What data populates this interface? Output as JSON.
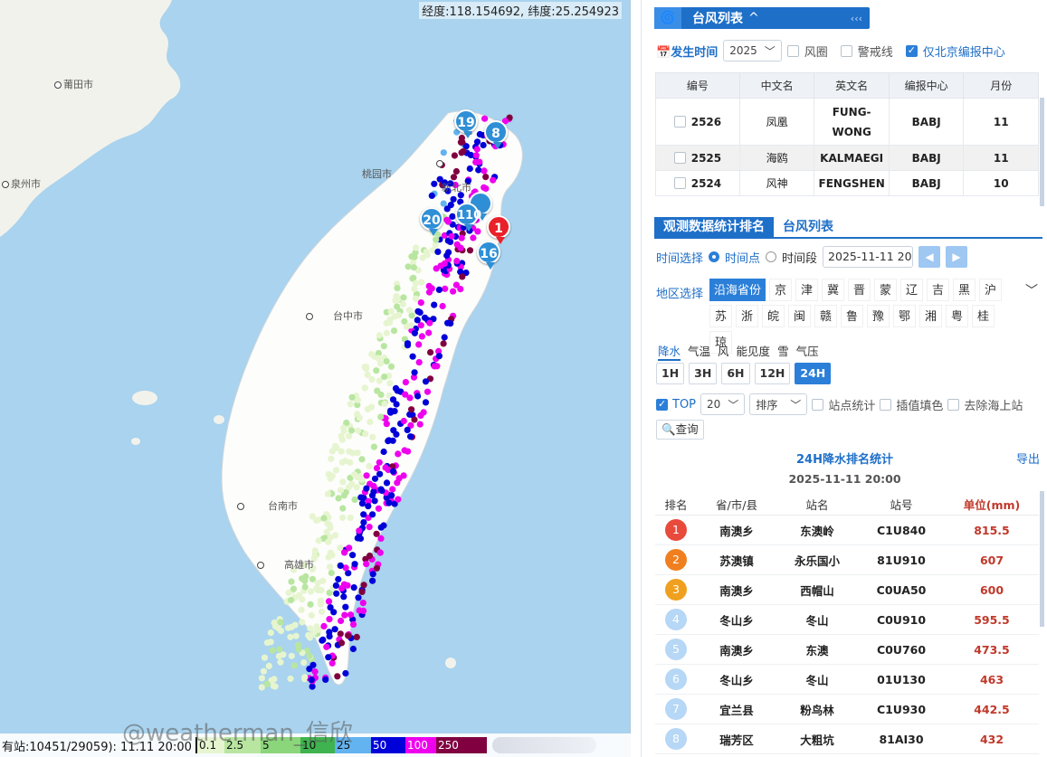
{
  "map": {
    "coord_text": "经度:118.154692, 纬度:25.254923",
    "cities": [
      {
        "id": "putian",
        "name": "莆田市"
      },
      {
        "id": "quanzhou",
        "name": "泉州市"
      },
      {
        "id": "taoyuan",
        "name": "桃园市"
      },
      {
        "id": "xinbei",
        "name": "新北市"
      },
      {
        "id": "taibei",
        "name": "市"
      },
      {
        "id": "taizhong",
        "name": "台中市"
      },
      {
        "id": "tainan",
        "name": "台南市"
      },
      {
        "id": "gaoxiong",
        "name": "高雄市"
      }
    ],
    "markers": [
      "19",
      "8",
      "20",
      "110",
      "1",
      "16"
    ],
    "marker_colors": {
      "normal": "#2f8fd6",
      "top": "#e8212b"
    },
    "station_stat": "有站:10451/29059): 11.11 20:00",
    "legend": [
      {
        "label": "0.1",
        "color": "#e6f5d0"
      },
      {
        "label": "2.5",
        "color": "#b8e6a0"
      },
      {
        "label": "5",
        "color": "#8bd57a"
      },
      {
        "label": "10",
        "color": "#3fb34f"
      },
      {
        "label": "25",
        "color": "#63b3f0"
      },
      {
        "label": "50",
        "color": "#0000d8"
      },
      {
        "label": "100",
        "color": "#ee00ee"
      },
      {
        "label": "250",
        "color": "#800040"
      },
      {
        "label": "",
        "color": "#800040"
      }
    ]
  },
  "typhoon": {
    "header_title": "台风列表",
    "header_caret": "^",
    "header_arrows": "‹‹‹",
    "filter_label": "发生时间",
    "year": "2025",
    "chk_wind": "风圈",
    "chk_warn": "警戒线",
    "chk_babj": "仅北京编报中心",
    "columns": [
      "编号",
      "中文名",
      "英文名",
      "编报中心",
      "月份"
    ],
    "rows": [
      {
        "id": "2526",
        "cn": "凤凰",
        "en": "FUNG-WONG",
        "center": "BABJ",
        "month": "11"
      },
      {
        "id": "2525",
        "cn": "海鸥",
        "en": "KALMAEGI",
        "center": "BABJ",
        "month": "11"
      },
      {
        "id": "2524",
        "cn": "风神",
        "en": "FENGSHEN",
        "center": "BABJ",
        "month": "10"
      }
    ]
  },
  "tabs": {
    "stats": "观测数据统计排名",
    "list": "台风列表"
  },
  "time": {
    "label": "时间选择",
    "point": "时间点",
    "period": "时间段",
    "value": "2025-11-11 20",
    "prev": "◀",
    "next": "▶"
  },
  "region": {
    "label": "地区选择",
    "expand": "﹀",
    "chips": [
      "沿海省份",
      "京",
      "津",
      "冀",
      "晋",
      "蒙",
      "辽",
      "吉",
      "黑",
      "沪",
      "苏",
      "浙",
      "皖",
      "闽",
      "赣",
      "鲁",
      "豫",
      "鄂",
      "湘",
      "粤",
      "桂",
      "琼"
    ]
  },
  "variables": [
    "降水",
    "气温",
    "风",
    "能见度",
    "雪",
    "气压"
  ],
  "hours": [
    "1H",
    "3H",
    "6H",
    "12H",
    "24H"
  ],
  "options": {
    "top_label": "TOP",
    "top_value": "20",
    "sort_label": "排序",
    "station_stat": "站点统计",
    "interp_fill": "插值填色",
    "remove_sea": "去除海上站",
    "query": "查询"
  },
  "ranking": {
    "title": "24H降水排名统计",
    "export": "导出",
    "date": "2025-11-11 20:00",
    "columns": [
      "排名",
      "省/市/县",
      "站名",
      "站号",
      "单位(mm)"
    ],
    "rows": [
      {
        "rank": "1",
        "region": "南澳乡",
        "station": "东澳岭",
        "code": "C1U840",
        "value": "815.5",
        "color": "#e84a3c"
      },
      {
        "rank": "2",
        "region": "苏澳镇",
        "station": "永乐国小",
        "code": "81U910",
        "value": "607",
        "color": "#f07f1f"
      },
      {
        "rank": "3",
        "region": "南澳乡",
        "station": "西帽山",
        "code": "C0UA50",
        "value": "600",
        "color": "#f0a01f"
      },
      {
        "rank": "4",
        "region": "冬山乡",
        "station": "冬山",
        "code": "C0U910",
        "value": "595.5",
        "color": "#b6d7f5"
      },
      {
        "rank": "5",
        "region": "南澳乡",
        "station": "东澳",
        "code": "C0U760",
        "value": "473.5",
        "color": "#b6d7f5"
      },
      {
        "rank": "6",
        "region": "冬山乡",
        "station": "冬山",
        "code": "01U130",
        "value": "463",
        "color": "#b6d7f5"
      },
      {
        "rank": "7",
        "region": "宜兰县",
        "station": "粉鸟林",
        "code": "C1U930",
        "value": "442.5",
        "color": "#b6d7f5"
      },
      {
        "rank": "8",
        "region": "瑞芳区",
        "station": "大粗坑",
        "code": "81AI30",
        "value": "432",
        "color": "#b6d7f5"
      }
    ]
  },
  "watermark": "@weatherman_信欣"
}
